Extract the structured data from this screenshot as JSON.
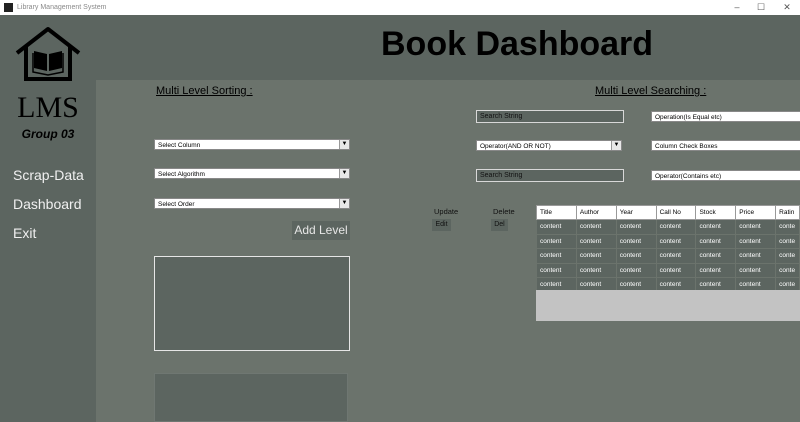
{
  "window": {
    "title": "Library Management System"
  },
  "sidebar": {
    "brand": "LMS",
    "group": "Group 03",
    "nav": [
      {
        "label": "Scrap-Data"
      },
      {
        "label": "Dashboard"
      },
      {
        "label": "Exit"
      }
    ]
  },
  "header": {
    "title": "Book Dashboard"
  },
  "sorting": {
    "title": "Multi Level Sorting :",
    "column": "Select Column",
    "algorithm": "Select Algorithm",
    "order": "Select Order",
    "add_level": "Add Level"
  },
  "searching": {
    "title": "Multi Level Searching :",
    "search_string_1": "Search String",
    "operation": "Operation(Is Equal etc)",
    "operator": "Operator(AND OR NOT)",
    "column_check_boxes": "Column Check Boxes",
    "search_string_2": "Search String",
    "contains_operator": "Operator(Contains etc)"
  },
  "actions": {
    "update_label": "Update",
    "delete_label": "Delete",
    "edit_button": "Edit",
    "del_button": "Del"
  },
  "table": {
    "columns": [
      "Title",
      "Author",
      "Year",
      "Call No",
      "Stock",
      "Price",
      "Ratin"
    ],
    "rows": [
      [
        "content",
        "content",
        "content",
        "content",
        "content",
        "content",
        "conte"
      ],
      [
        "content",
        "content",
        "content",
        "content",
        "content",
        "content",
        "conte"
      ],
      [
        "content",
        "content",
        "content",
        "content",
        "content",
        "content",
        "conte"
      ],
      [
        "content",
        "content",
        "content",
        "content",
        "content",
        "content",
        "conte"
      ],
      [
        "content",
        "content",
        "content",
        "content",
        "content",
        "content",
        "conte"
      ]
    ]
  }
}
